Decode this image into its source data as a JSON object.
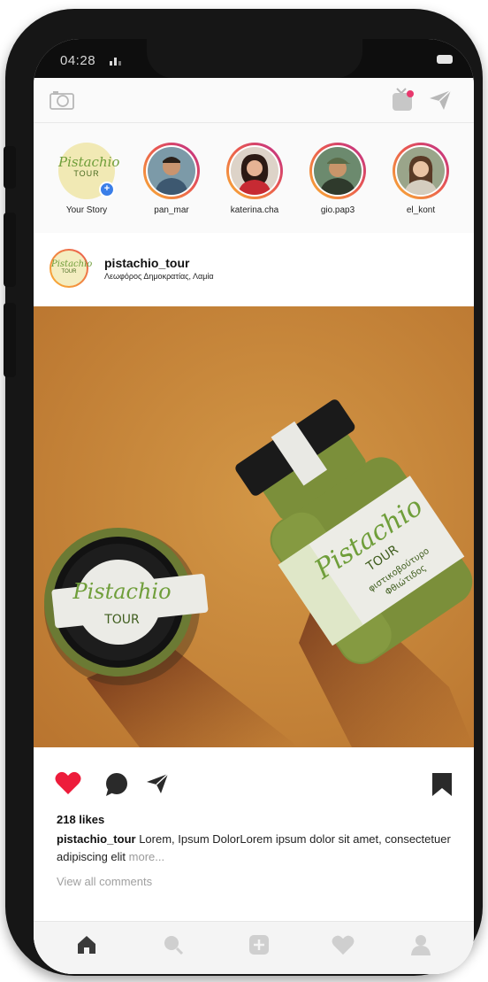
{
  "status_bar": {
    "time": "04:28"
  },
  "top_bar": {
    "left_icon": "camera-icon",
    "right_icons": [
      "igtv-icon",
      "direct-message-icon"
    ],
    "accent": "#e8386d"
  },
  "stories": [
    {
      "name": "Your Story",
      "own": true,
      "badge": "+"
    },
    {
      "name": "pan_mar"
    },
    {
      "name": "katerina.cha"
    },
    {
      "name": "gio.pap3"
    },
    {
      "name": "el_kont"
    }
  ],
  "brand": {
    "word1": "Pistachio",
    "word2": "TOUR"
  },
  "post": {
    "username": "pistachio_tour",
    "location": "Λεωφόρος Δημοκρατίας, Λαμία",
    "jar_label": {
      "line1": "φιστικοβούτυρο",
      "line2": "Φθιώτιδος"
    },
    "likes": "218 likes",
    "caption_user": "pistachio_tour",
    "caption_text": "Lorem, Ipsum DolorLorem ipsum dolor sit amet, consectetuer adipiscing elit",
    "caption_more": "more...",
    "view_comments": "View all comments",
    "liked": true,
    "like_color": "#ed1c3b"
  },
  "bottom_nav": [
    "home-icon",
    "search-icon",
    "add-post-icon",
    "activity-heart-icon",
    "profile-icon"
  ]
}
